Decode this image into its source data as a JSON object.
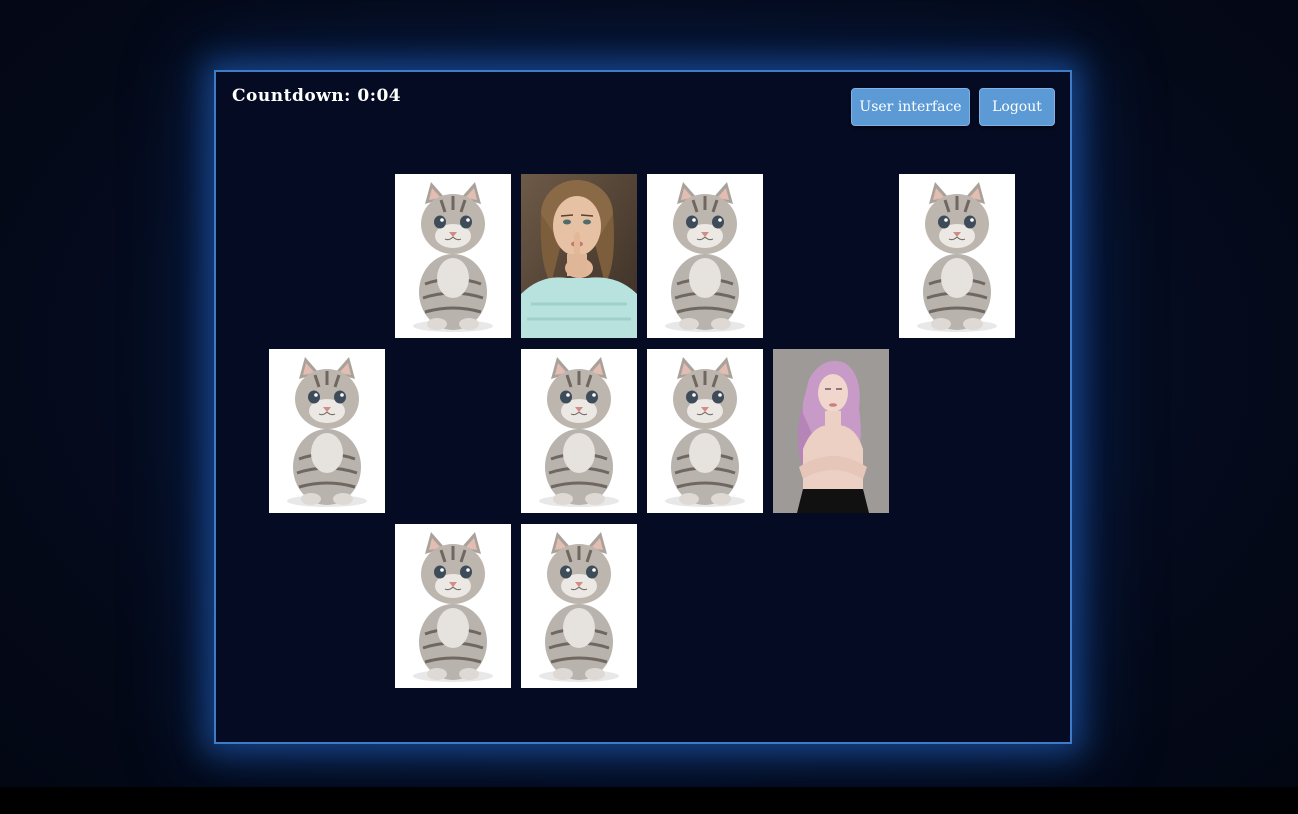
{
  "countdown": {
    "label": "Countdown:",
    "value": "0:04"
  },
  "buttons": {
    "user_interface": "User interface",
    "logout": "Logout"
  },
  "grid": {
    "rows": 3,
    "cols": 6,
    "cards": [
      {
        "row": 0,
        "col": 1,
        "image": "kitten"
      },
      {
        "row": 0,
        "col": 2,
        "image": "woman-finger-lips"
      },
      {
        "row": 0,
        "col": 3,
        "image": "kitten"
      },
      {
        "row": 0,
        "col": 5,
        "image": "kitten"
      },
      {
        "row": 1,
        "col": 0,
        "image": "kitten"
      },
      {
        "row": 1,
        "col": 2,
        "image": "kitten"
      },
      {
        "row": 1,
        "col": 3,
        "image": "kitten"
      },
      {
        "row": 1,
        "col": 4,
        "image": "woman-pink-hair"
      },
      {
        "row": 2,
        "col": 1,
        "image": "kitten"
      },
      {
        "row": 2,
        "col": 2,
        "image": "kitten"
      }
    ]
  },
  "colors": {
    "panel_border": "#3f7cc8",
    "button_bg": "#5c9ad6",
    "background": "#050b22"
  }
}
